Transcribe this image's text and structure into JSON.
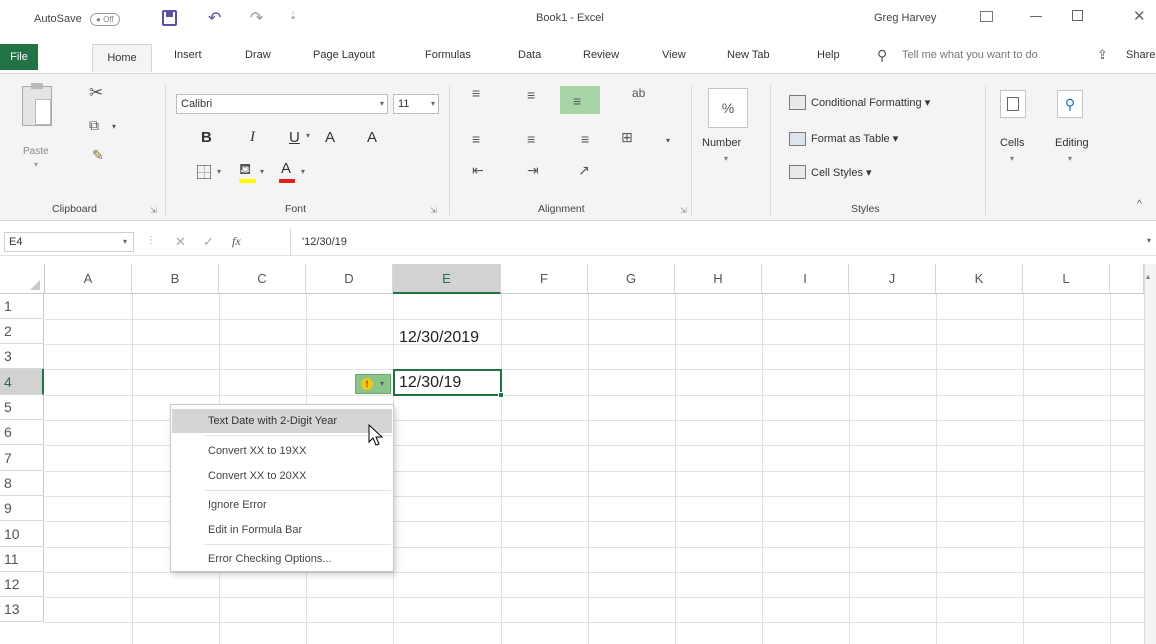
{
  "titlebar": {
    "autosave_label": "AutoSave",
    "autosave_state": "Off",
    "title": "Book1 - Excel",
    "user": "Greg Harvey"
  },
  "tabs": {
    "file": "File",
    "home": "Home",
    "insert": "Insert",
    "draw": "Draw",
    "page_layout": "Page Layout",
    "formulas": "Formulas",
    "data": "Data",
    "review": "Review",
    "view": "View",
    "new_tab": "New Tab",
    "help": "Help",
    "tell_me_placeholder": "Tell me what you want to do",
    "share": "Share"
  },
  "ribbon": {
    "clipboard": {
      "paste": "Paste",
      "label": "Clipboard"
    },
    "font": {
      "name": "Calibri",
      "size": "11",
      "bold": "B",
      "italic": "I",
      "underline": "U",
      "grow": "A",
      "shrink": "A",
      "font_color": "A",
      "label": "Font"
    },
    "alignment": {
      "label": "Alignment"
    },
    "number": {
      "label": "Number"
    },
    "styles": {
      "conditional_formatting": "Conditional Formatting",
      "format_as_table": "Format as Table",
      "cell_styles": "Cell Styles",
      "label": "Styles"
    },
    "cells": {
      "label": "Cells"
    },
    "editing": {
      "label": "Editing"
    }
  },
  "formula_bar": {
    "name_box": "E4",
    "fx": "fx",
    "content": "'12/30/19"
  },
  "grid": {
    "columns": [
      "A",
      "B",
      "C",
      "D",
      "E",
      "F",
      "G",
      "H",
      "I",
      "J",
      "K",
      "L"
    ],
    "rows": [
      "1",
      "2",
      "3",
      "4",
      "5",
      "6",
      "7",
      "8",
      "9",
      "10",
      "11",
      "12",
      "13"
    ],
    "e2": "12/30/2019",
    "e4": "12/30/19",
    "error_icon": "!"
  },
  "context_menu": {
    "items": [
      "Text Date with 2-Digit Year",
      "Convert XX to 19XX",
      "Convert XX to 20XX",
      "Ignore Error",
      "Edit in Formula Bar",
      "Error Checking Options..."
    ]
  },
  "colors": {
    "excel_green": "#217346",
    "ribbon_bg": "#f4f4f4",
    "selected_header": "#d2d2d2",
    "menu_highlight": "#d5d5d5"
  }
}
